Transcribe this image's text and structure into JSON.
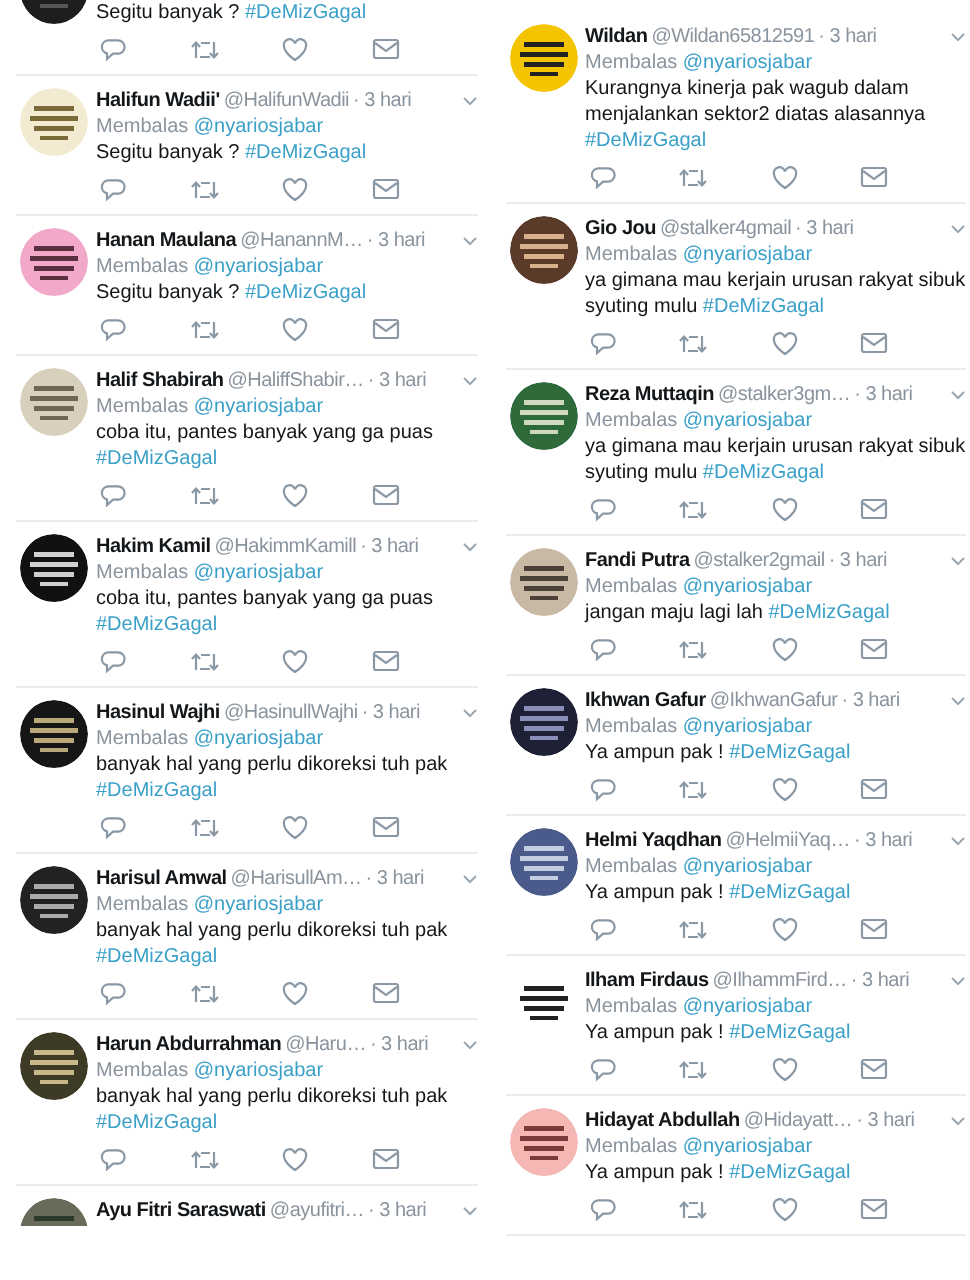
{
  "columns": [
    {
      "tweets": [
        {
          "kind": "body_only",
          "text": "Segitu banyak ?",
          "hashtag": "#DeMizGagal"
        },
        {
          "kind": "full",
          "name": "Halifun Wadii'",
          "handle": "@HalifunWadii",
          "time": "· 3 hari",
          "reply_label": "Membalas",
          "reply_to": "@nyariosjabar",
          "text": "Segitu banyak ?",
          "hashtag": "#DeMizGagal"
        },
        {
          "kind": "full",
          "name": "Hanan Maulana",
          "handle": "@HanannM…",
          "time": "· 3 hari",
          "reply_label": "Membalas",
          "reply_to": "@nyariosjabar",
          "text": "Segitu banyak ?",
          "hashtag": "#DeMizGagal"
        },
        {
          "kind": "full",
          "name": "Halif Shabirah",
          "handle": "@HaliffShabir…",
          "time": "· 3 hari",
          "reply_label": "Membalas",
          "reply_to": "@nyariosjabar",
          "text": "coba itu, pantes banyak yang ga puas",
          "hashtag": "#DeMizGagal"
        },
        {
          "kind": "full",
          "name": "Hakim Kamil",
          "handle": "@HakimmKamill",
          "time": "· 3 hari",
          "reply_label": "Membalas",
          "reply_to": "@nyariosjabar",
          "text": "coba itu, pantes banyak yang ga puas",
          "hashtag": "#DeMizGagal"
        },
        {
          "kind": "full",
          "name": "Hasinul Wajhi",
          "handle": "@HasinullWajhi",
          "time": "· 3 hari",
          "reply_label": "Membalas",
          "reply_to": "@nyariosjabar",
          "text": "banyak hal yang perlu dikoreksi tuh pak",
          "hashtag": "#DeMizGagal"
        },
        {
          "kind": "full",
          "name": "Harisul Amwal",
          "handle": "@HarisullAm…",
          "time": "· 3 hari",
          "reply_label": "Membalas",
          "reply_to": "@nyariosjabar",
          "text": "banyak hal yang perlu dikoreksi tuh pak",
          "hashtag": "#DeMizGagal"
        },
        {
          "kind": "full",
          "name": "Harun Abdurrahman",
          "handle": "@Haru…",
          "time": "· 3 hari",
          "reply_label": "Membalas",
          "reply_to": "@nyariosjabar",
          "text": "banyak hal yang perlu dikoreksi tuh pak",
          "hashtag": "#DeMizGagal"
        },
        {
          "kind": "header_only",
          "name": "Ayu Fitri Saraswati",
          "handle": "@ayufitri…",
          "time": "· 3 hari"
        }
      ]
    },
    {
      "tweets": [
        {
          "kind": "full",
          "name": "Wildan",
          "handle": "@Wildan65812591",
          "time": "· 3 hari",
          "reply_label": "Membalas",
          "reply_to": "@nyariosjabar",
          "text": "Kurangnya kinerja pak wagub dalam menjalankan sektor2 diatas alasannya",
          "hashtag": "#DeMizGagal"
        },
        {
          "kind": "full",
          "name": "Gio Jou",
          "handle": "@stalker4gmail",
          "time": "· 3 hari",
          "reply_label": "Membalas",
          "reply_to": "@nyariosjabar",
          "text": "ya gimana mau kerjain urusan rakyat sibuk syuting mulu",
          "hashtag": "#DeMizGagal"
        },
        {
          "kind": "full",
          "name": "Reza Muttaqin",
          "handle": "@stalker3gm…",
          "time": "· 3 hari",
          "reply_label": "Membalas",
          "reply_to": "@nyariosjabar",
          "text": "ya gimana mau kerjain urusan rakyat sibuk syuting mulu",
          "hashtag": "#DeMizGagal"
        },
        {
          "kind": "full",
          "name": "Fandi Putra",
          "handle": "@stalker2gmail",
          "time": "· 3 hari",
          "reply_label": "Membalas",
          "reply_to": "@nyariosjabar",
          "text": "jangan maju lagi lah",
          "hashtag": "#DeMizGagal"
        },
        {
          "kind": "full",
          "name": "Ikhwan Gafur",
          "handle": "@IkhwanGafur",
          "time": "· 3 hari",
          "reply_label": "Membalas",
          "reply_to": "@nyariosjabar",
          "text": "Ya ampun pak !",
          "hashtag": "#DeMizGagal"
        },
        {
          "kind": "full",
          "name": "Helmi Yaqdhan",
          "handle": "@HelmiiYaq…",
          "time": "· 3 hari",
          "reply_label": "Membalas",
          "reply_to": "@nyariosjabar",
          "text": "Ya ampun pak !",
          "hashtag": "#DeMizGagal"
        },
        {
          "kind": "full",
          "name": "Ilham Firdaus",
          "handle": "@IlhammFird…",
          "time": "· 3 hari",
          "reply_label": "Membalas",
          "reply_to": "@nyariosjabar",
          "text": "Ya ampun pak !",
          "hashtag": "#DeMizGagal"
        },
        {
          "kind": "full",
          "name": "Hidayat Abdullah",
          "handle": "@Hidayatt…",
          "time": "· 3 hari",
          "reply_label": "Membalas",
          "reply_to": "@nyariosjabar",
          "text": "Ya ampun pak !",
          "hashtag": "#DeMizGagal"
        }
      ]
    }
  ]
}
